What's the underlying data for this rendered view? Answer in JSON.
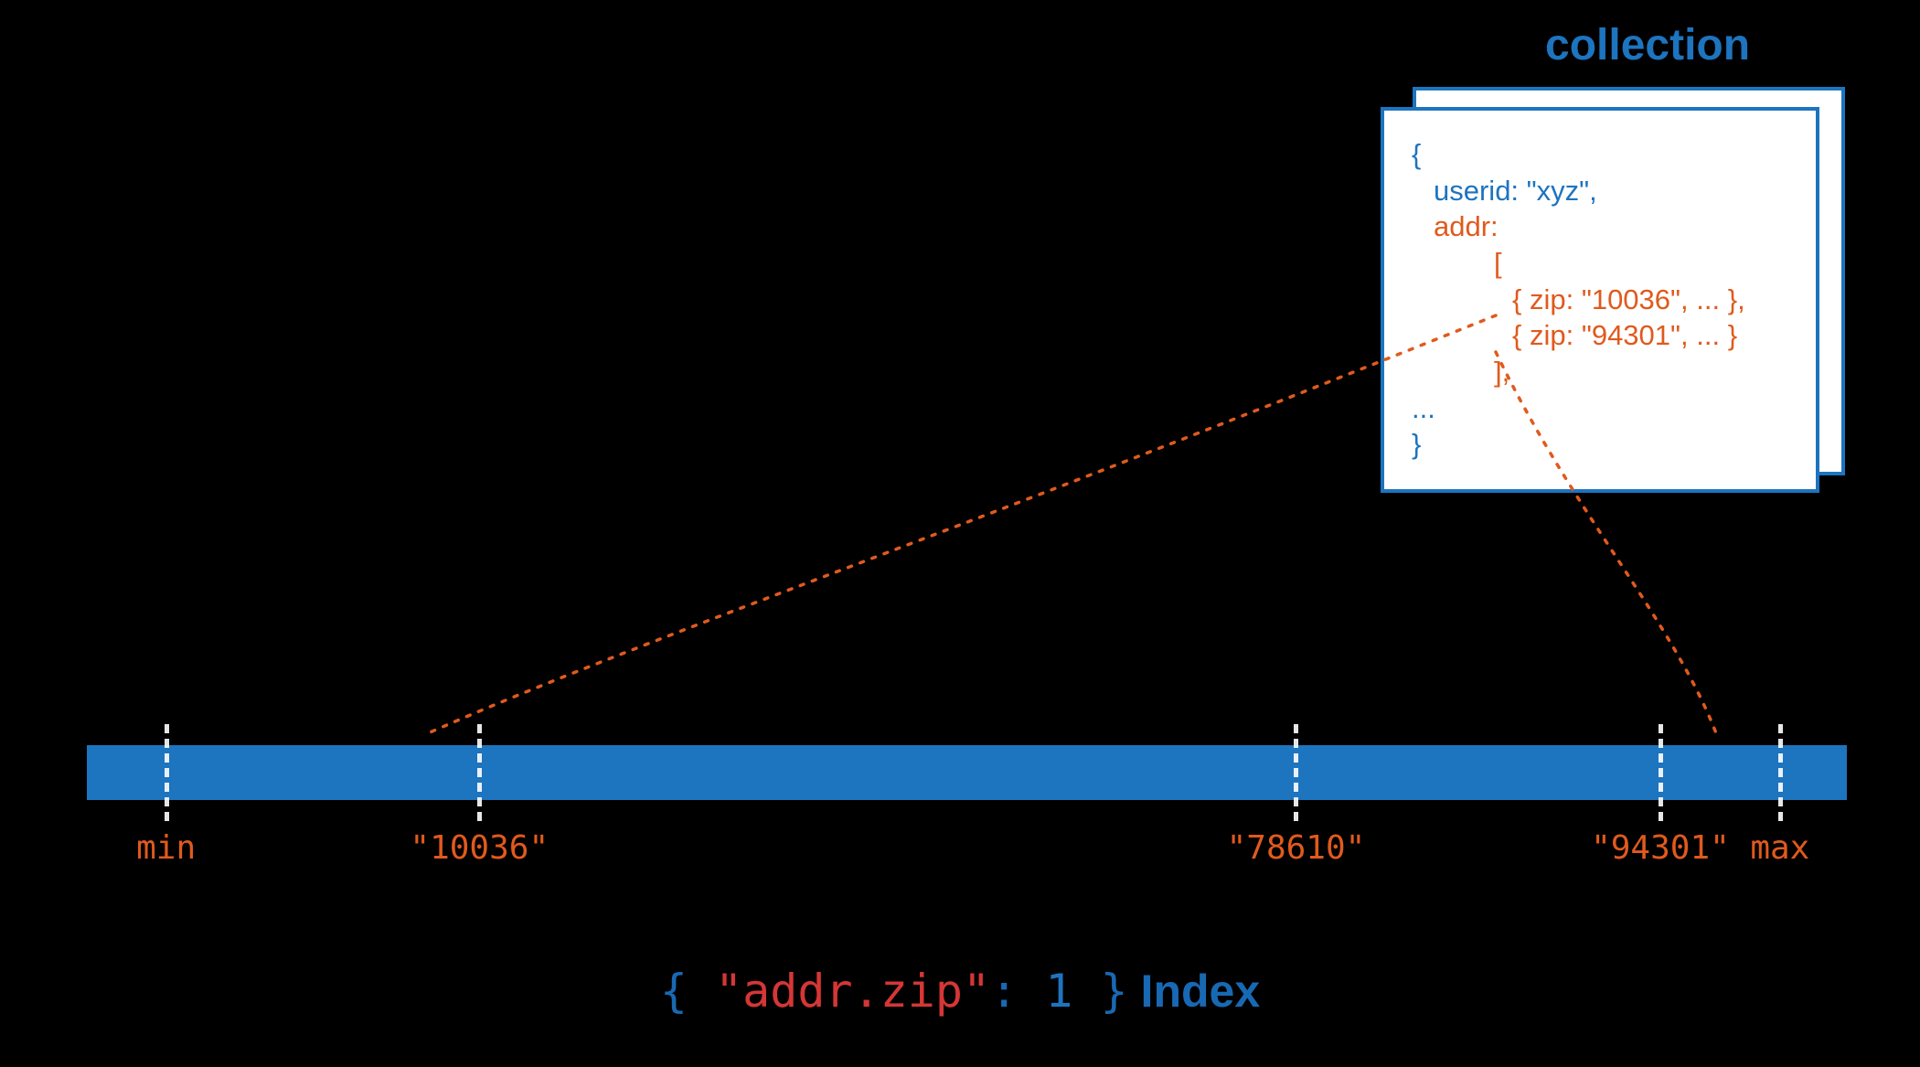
{
  "collection": {
    "title": "collection",
    "doc": {
      "open_brace": "{",
      "userid_line": "userid: \"xyz\",",
      "addr_label": "addr:",
      "array_open": "[",
      "zip1": "{ zip: \"10036\", ... },",
      "zip2": "{ zip: \"94301\", ... }",
      "array_close": "],",
      "ellipsis": "...",
      "close_brace": "}"
    }
  },
  "index_bar": {
    "ticks": [
      {
        "label": "min",
        "pos_pct": 4.5
      },
      {
        "label": "\"10036\"",
        "pos_pct": 22.3
      },
      {
        "label": "\"78610\"",
        "pos_pct": 68.7
      },
      {
        "label": "\"94301\"",
        "pos_pct": 89.4
      },
      {
        "label": "max",
        "pos_pct": 96.2
      }
    ]
  },
  "caption": {
    "lbrace": "{ ",
    "field": "\"addr.zip\"",
    "colon": ": ",
    "value": "1",
    "rbrace": " }",
    "word_index": " Index"
  }
}
